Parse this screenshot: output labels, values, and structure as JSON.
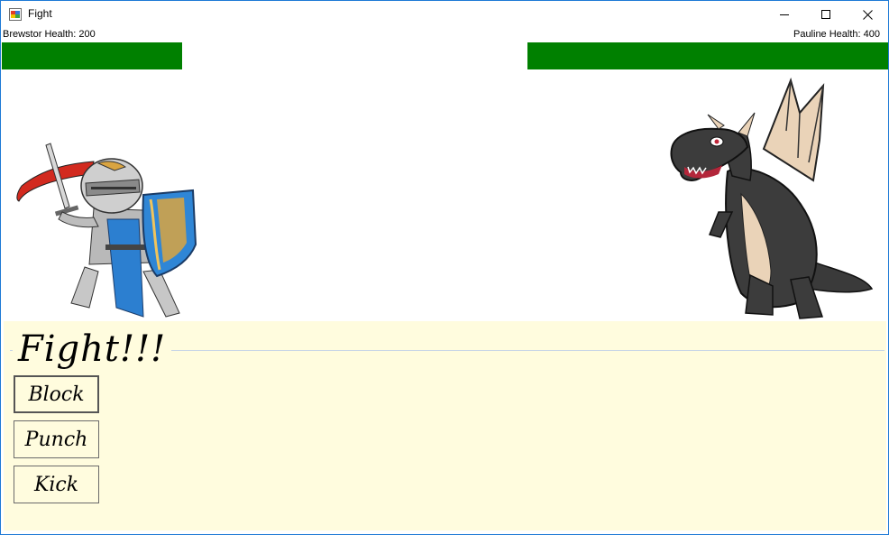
{
  "window": {
    "title": "Fight",
    "controls": {
      "minimize": "minimize",
      "maximize": "maximize",
      "close": "close"
    }
  },
  "player": {
    "label": "Brewstor Health: 200",
    "health": 200,
    "bar_color": "#008000"
  },
  "enemy": {
    "label": "Pauline Health: 400",
    "health": 400,
    "bar_color": "#008000"
  },
  "fight_panel": {
    "title": "Fight!!!",
    "background": "#fffcde",
    "actions": [
      {
        "label": "Block"
      },
      {
        "label": "Punch"
      },
      {
        "label": "Kick"
      }
    ]
  },
  "colors": {
    "accent": "#1e7ad6"
  }
}
